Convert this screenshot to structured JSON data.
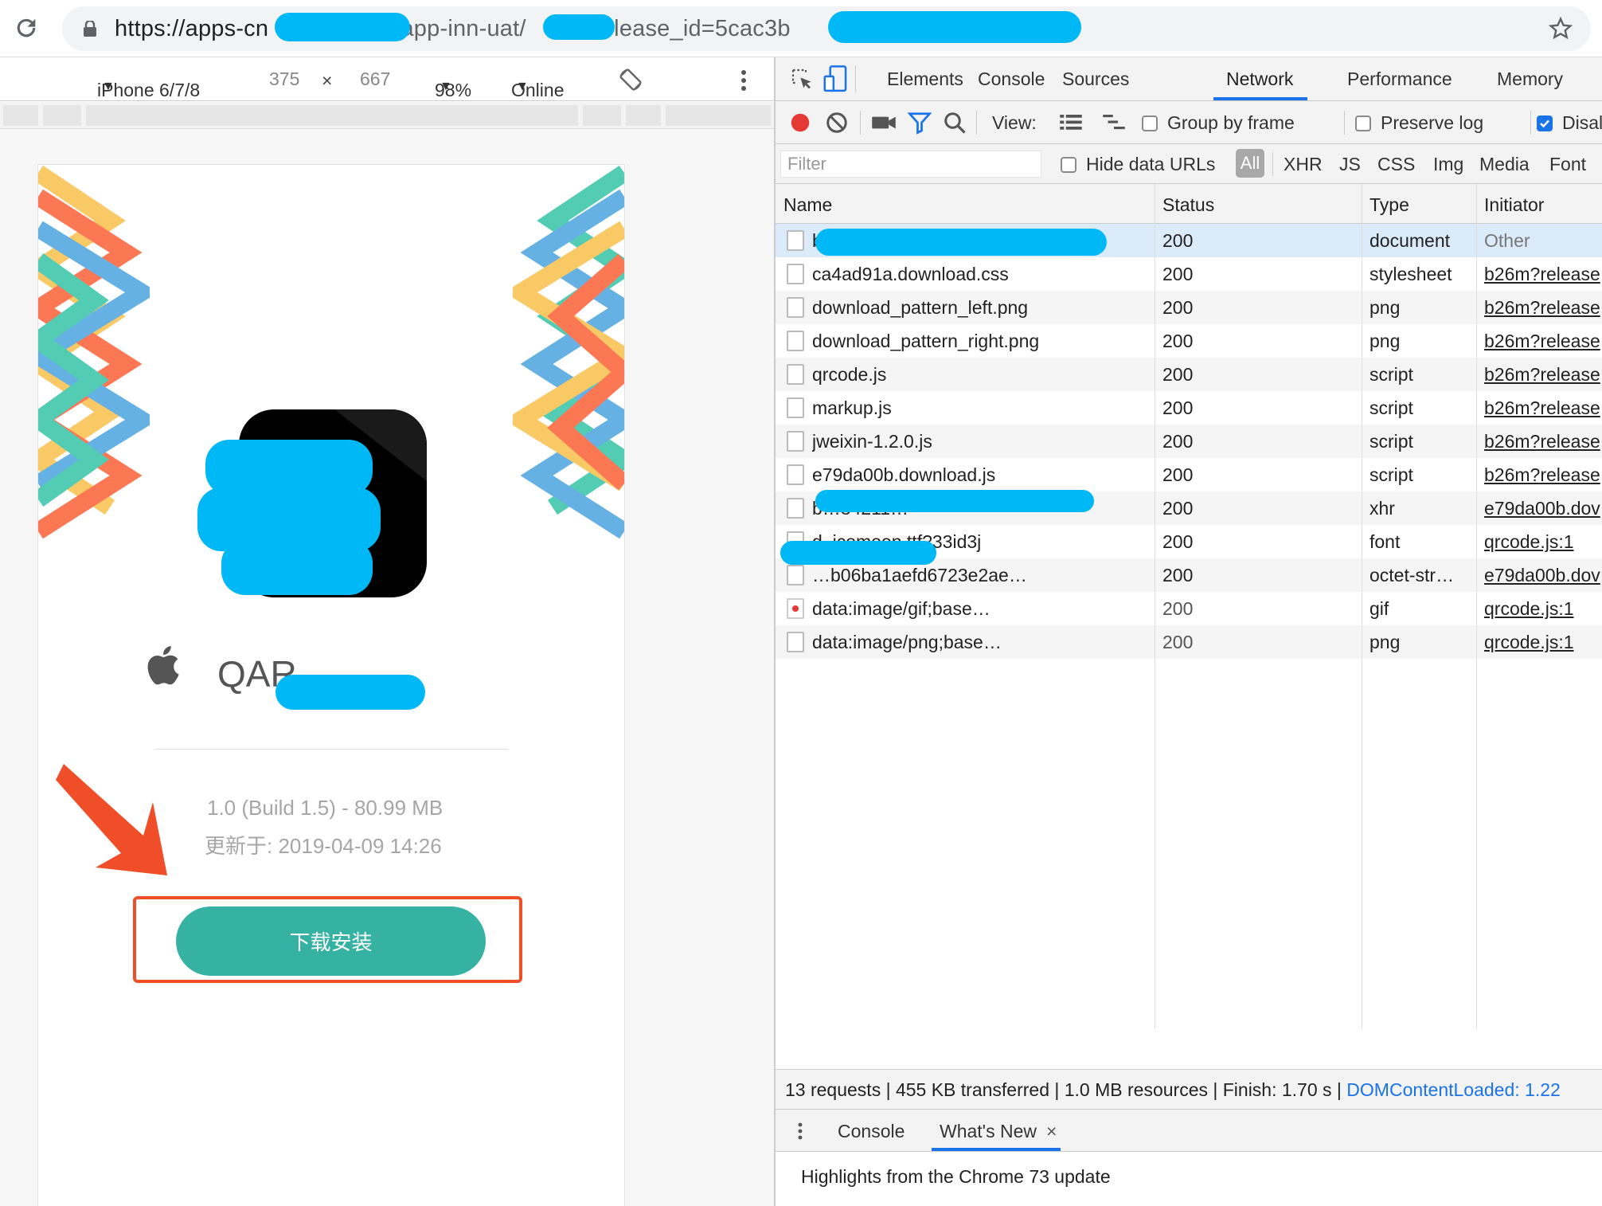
{
  "browser": {
    "url_host": "https://apps-cn",
    "url_path": "/app-inn-uat/",
    "url_query": "?release_id=5cac3b"
  },
  "device_toolbar": {
    "device": "iPhone 6/7/8",
    "width": "375",
    "times": "×",
    "height": "667",
    "zoom": "98%",
    "network": "Online"
  },
  "app_page": {
    "app_name": "QAR-",
    "build_info": "1.0 (Build 1.5) - 80.99 MB",
    "updated": "更新于: 2019-04-09 14:26",
    "install_label": "下载安装",
    "accent_color": "#36b2a3",
    "highlight_color": "#f04e28"
  },
  "devtools": {
    "tabs": [
      "Elements",
      "Console",
      "Sources",
      "Network",
      "Performance",
      "Memory"
    ],
    "active_tab": "Network",
    "toolbar": {
      "view_label": "View:",
      "group_by_frame": "Group by frame",
      "preserve_log": "Preserve log",
      "disable_cache": "Disal"
    },
    "filter": {
      "placeholder": "Filter",
      "hide_data_urls": "Hide data URLs",
      "types": [
        "All",
        "XHR",
        "JS",
        "CSS",
        "Img",
        "Media",
        "Font"
      ]
    },
    "columns": [
      "Name",
      "Status",
      "Type",
      "Initiator"
    ],
    "rows": [
      {
        "name": "b26m?release_id=5cac3b…211…",
        "status": "200",
        "type": "document",
        "initiator": "Other"
      },
      {
        "name": "ca4ad91a.download.css",
        "status": "200",
        "type": "stylesheet",
        "initiator": "b26m?release"
      },
      {
        "name": "download_pattern_left.png",
        "status": "200",
        "type": "png",
        "initiator": "b26m?release"
      },
      {
        "name": "download_pattern_right.png",
        "status": "200",
        "type": "png",
        "initiator": "b26m?release"
      },
      {
        "name": "qrcode.js",
        "status": "200",
        "type": "script",
        "initiator": "b26m?release"
      },
      {
        "name": "markup.js",
        "status": "200",
        "type": "script",
        "initiator": "b26m?release"
      },
      {
        "name": "jweixin-1.2.0.js",
        "status": "200",
        "type": "script",
        "initiator": "b26m?release"
      },
      {
        "name": "e79da00b.download.js",
        "status": "200",
        "type": "script",
        "initiator": "b26m?release"
      },
      {
        "name": "b…84211…",
        "status": "200",
        "type": "xhr",
        "initiator": "e79da00b.dov"
      },
      {
        "name": "d_icomoon.ttf?33id3j",
        "status": "200",
        "type": "font",
        "initiator": "qrcode.js:1"
      },
      {
        "name": "…b06ba1aefd6723e2ae…",
        "status": "200",
        "type": "octet-str…",
        "initiator": "e79da00b.dov"
      },
      {
        "name": "data:image/gif;base…",
        "status": "200",
        "type": "gif",
        "initiator": "qrcode.js:1"
      },
      {
        "name": "data:image/png;base…",
        "status": "200",
        "type": "png",
        "initiator": "qrcode.js:1"
      }
    ],
    "summary": "13 requests | 455 KB transferred | 1.0 MB resources | Finish: 1.70 s | ",
    "dom_content_loaded": "DOMContentLoaded: 1.22",
    "drawer": {
      "tabs": [
        "Console",
        "What's New"
      ],
      "close": "×",
      "highlights": "Highlights from the Chrome 73 update"
    }
  }
}
